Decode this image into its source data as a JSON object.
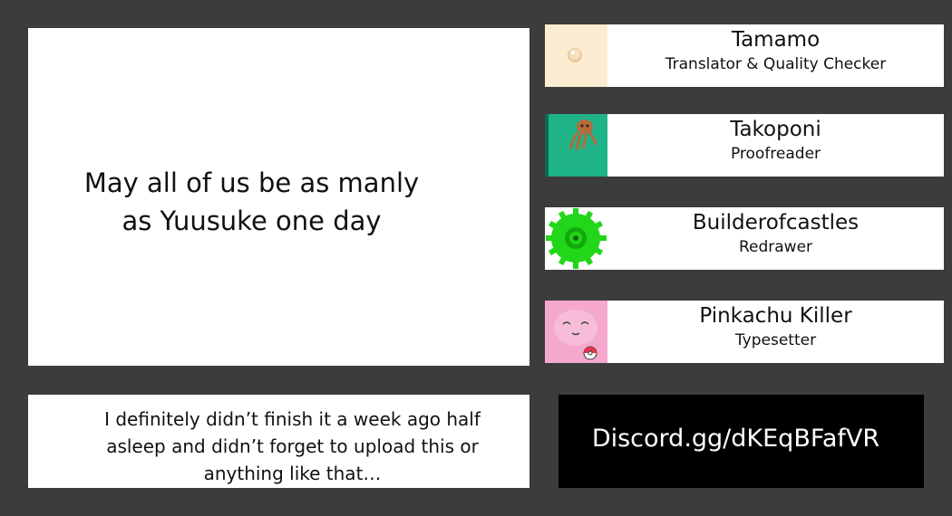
{
  "main_message": {
    "lines": [
      "May all of us be as manly",
      "as Yuusuke one day"
    ]
  },
  "note": {
    "lines": [
      "I definitely didn’t finish it a week ago half",
      "asleep and didn’t forget to upload this or",
      "anything like that…"
    ]
  },
  "credits": [
    {
      "name": "Tamamo",
      "role": "Translator & Quality Checker",
      "avatar": "cream-ball-avatar"
    },
    {
      "name": "Takoponi",
      "role": "Proofreader",
      "avatar": "octopus-avatar"
    },
    {
      "name": "Builderofcastles",
      "role": "Redrawer",
      "avatar": "green-gear-avatar"
    },
    {
      "name": "Pinkachu Killer",
      "role": "Typesetter",
      "avatar": "pink-creature-avatar"
    }
  ],
  "discord": {
    "text": "Discord.gg/dKEqBFafVR"
  },
  "colors": {
    "background": "#3c3c3c",
    "panel": "#ffffff",
    "discord_bg": "#000000",
    "avatar_tamamo_bg": "#fbecd2",
    "avatar_takoponi_bg": "#1fb388",
    "avatar_gear": "#22d61a",
    "avatar_pink": "#f4a9cc"
  }
}
